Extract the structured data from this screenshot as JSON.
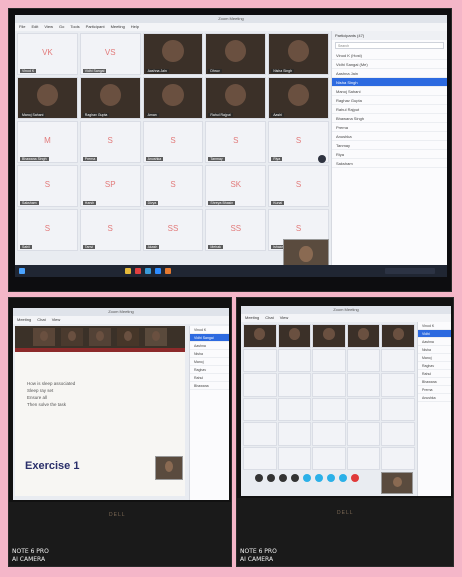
{
  "top": {
    "window_title": "Zoom Meeting",
    "menu": [
      "File",
      "Edit",
      "View",
      "Go",
      "Tools",
      "Participant",
      "Meeting",
      "Help"
    ],
    "tiles": [
      {
        "name": "Vinod K",
        "initials": "VK",
        "video": false
      },
      {
        "name": "Vidhi Sangai",
        "initials": "VS",
        "video": false
      },
      {
        "name": "Aashna Jain",
        "initials": "",
        "video": true
      },
      {
        "name": "Dhruv",
        "initials": "",
        "video": true
      },
      {
        "name": "Nisha Singh",
        "initials": "",
        "video": true
      },
      {
        "name": "Manoj Sahani",
        "initials": "",
        "video": true
      },
      {
        "name": "Raghav Gupta",
        "initials": "",
        "video": true
      },
      {
        "name": "Aman",
        "initials": "",
        "video": true
      },
      {
        "name": "Rahul Rajput",
        "initials": "",
        "video": true
      },
      {
        "name": "Aashi",
        "initials": "",
        "video": true
      },
      {
        "name": "Bhawana Singh",
        "initials": "M",
        "video": false
      },
      {
        "name": "Prerna",
        "initials": "S",
        "video": false
      },
      {
        "name": "Anushka",
        "initials": "S",
        "video": false
      },
      {
        "name": "Tanmay",
        "initials": "S",
        "video": false
      },
      {
        "name": "Riya",
        "initials": "S",
        "video": false
      },
      {
        "name": "Saksham",
        "initials": "S",
        "video": false
      },
      {
        "name": "Harsh",
        "initials": "SP",
        "video": false
      },
      {
        "name": "Divya",
        "initials": "S",
        "video": false
      },
      {
        "name": "Shreya Bhasin",
        "initials": "SK",
        "video": false
      },
      {
        "name": "Kunal",
        "initials": "S",
        "video": false
      },
      {
        "name": "Sahil",
        "initials": "S",
        "video": false
      },
      {
        "name": "Tanvi",
        "initials": "S",
        "video": false
      },
      {
        "name": "Akash",
        "initials": "SS",
        "video": false
      },
      {
        "name": "Mehak",
        "initials": "SS",
        "video": false
      },
      {
        "name": "Ishaan",
        "initials": "S",
        "video": false
      }
    ],
    "panel_title": "Participants (47)",
    "search_placeholder": "Search",
    "participants": [
      "Vinod K (Host)",
      "Vidhi Sangai (Me)",
      "Aashna Jain",
      "Nisha Singh",
      "Manoj Sahani",
      "Raghav Gupta",
      "Rahul Rajput",
      "Bhawana Singh",
      "Prerna",
      "Anushka",
      "Tanmay",
      "Riya",
      "Saksham"
    ],
    "selected_index": 3
  },
  "bottom_left": {
    "window_title": "Zoom Meeting",
    "menu": [
      "Meeting",
      "Chat",
      "View"
    ],
    "bullets": [
      "How is sleep associated",
      "Sleep ray set",
      "Ensure all",
      "Then solve the task"
    ],
    "slide_title": "Exercise 1",
    "participants": [
      "Vinod K",
      "Vidhi Sangai",
      "Aashna",
      "Nisha",
      "Manoj",
      "Raghav",
      "Rahul",
      "Bhawana"
    ],
    "camera_line1": "NOTE 6 PRO",
    "camera_line2": "AI CAMERA",
    "brand": "DELL"
  },
  "bottom_right": {
    "window_title": "Zoom Meeting",
    "menu": [
      "Meeting",
      "Chat",
      "View"
    ],
    "participants": [
      "Vinod K",
      "Vidhi",
      "Aashna",
      "Nisha",
      "Manoj",
      "Raghav",
      "Rahul",
      "Bhawana",
      "Prerna",
      "Anushka"
    ],
    "camera_line1": "NOTE 6 PRO",
    "camera_line2": "AI CAMERA",
    "brand": "DELL"
  },
  "colors": {
    "border_bg": "#f4b6c8",
    "accent": "#2d6ae0"
  }
}
